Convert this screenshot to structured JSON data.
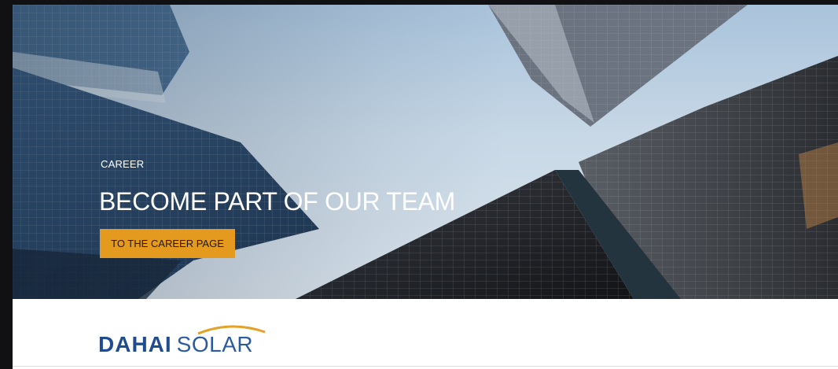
{
  "hero": {
    "eyebrow": "CAREER",
    "headline": "BECOME PART OF OUR TEAM",
    "cta_label": "TO THE CAREER PAGE",
    "cta_color": "#e39a1f"
  },
  "brand": {
    "name_bold": "DAHAI",
    "name_light": "SOLAR",
    "color": "#1f4c8f",
    "arc_color": "#e3a126"
  }
}
